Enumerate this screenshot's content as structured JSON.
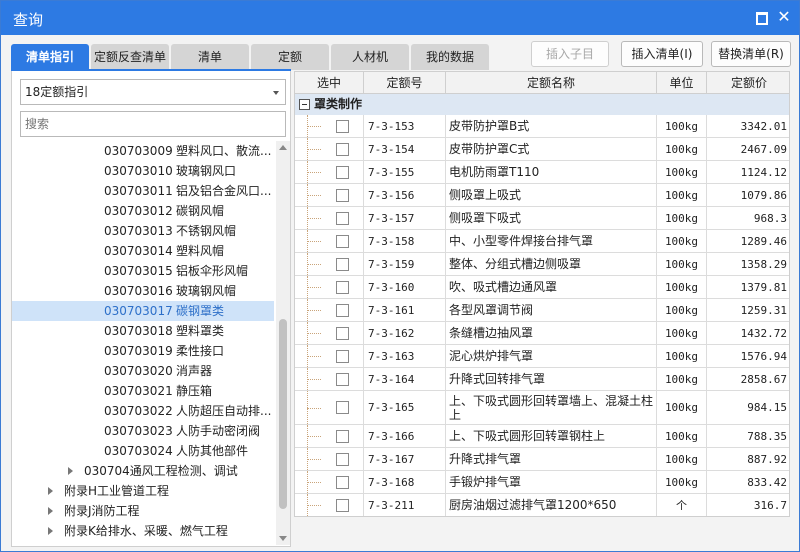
{
  "window": {
    "title": "查询"
  },
  "tabs": [
    {
      "label": "清单指引",
      "active": true
    },
    {
      "label": "定额反查清单",
      "active": false
    },
    {
      "label": "清单",
      "active": false
    },
    {
      "label": "定额",
      "active": false
    },
    {
      "label": "人材机",
      "active": false
    },
    {
      "label": "我的数据",
      "active": false
    }
  ],
  "toolbar": {
    "insert_child": "插入子目",
    "insert_list": "插入清单(I)",
    "replace_list": "替换清单(R)"
  },
  "left": {
    "select_value": "18定额指引",
    "search_placeholder": "搜索",
    "items": [
      {
        "code": "030703009",
        "name": "塑料风口、散流..."
      },
      {
        "code": "030703010",
        "name": "玻璃钢风口"
      },
      {
        "code": "030703011",
        "name": "铝及铝合金风口..."
      },
      {
        "code": "030703012",
        "name": "碳钢风帽"
      },
      {
        "code": "030703013",
        "name": "不锈钢风帽"
      },
      {
        "code": "030703014",
        "name": "塑料风帽"
      },
      {
        "code": "030703015",
        "name": "铝板伞形风帽"
      },
      {
        "code": "030703016",
        "name": "玻璃钢风帽"
      },
      {
        "code": "030703017",
        "name": "碳钢罩类"
      },
      {
        "code": "030703018",
        "name": "塑料罩类"
      },
      {
        "code": "030703019",
        "name": "柔性接口"
      },
      {
        "code": "030703020",
        "name": "消声器"
      },
      {
        "code": "030703021",
        "name": "静压箱"
      },
      {
        "code": "030703022",
        "name": "人防超压自动排..."
      },
      {
        "code": "030703023",
        "name": "人防手动密闭阀"
      },
      {
        "code": "030703024",
        "name": "人防其他部件"
      }
    ],
    "nodes": [
      "030704通风工程检测、调试",
      "附录H工业管道工程",
      "附录J消防工程",
      "附录K给排水、采暖、燃气工程"
    ]
  },
  "grid": {
    "headers": {
      "select": "选中",
      "code": "定额号",
      "name": "定额名称",
      "unit": "单位",
      "price": "定额价"
    },
    "group": "罩类制作",
    "rows": [
      {
        "code": "7-3-153",
        "name": "皮带防护罩B式",
        "unit": "100kg",
        "price": "3342.01"
      },
      {
        "code": "7-3-154",
        "name": "皮带防护罩C式",
        "unit": "100kg",
        "price": "2467.09"
      },
      {
        "code": "7-3-155",
        "name": "电机防雨罩T110",
        "unit": "100kg",
        "price": "1124.12"
      },
      {
        "code": "7-3-156",
        "name": "侧吸罩上吸式",
        "unit": "100kg",
        "price": "1079.86"
      },
      {
        "code": "7-3-157",
        "name": "侧吸罩下吸式",
        "unit": "100kg",
        "price": "968.3"
      },
      {
        "code": "7-3-158",
        "name": "中、小型零件焊接台排气罩",
        "unit": "100kg",
        "price": "1289.46"
      },
      {
        "code": "7-3-159",
        "name": "整体、分组式槽边侧吸罩",
        "unit": "100kg",
        "price": "1358.29"
      },
      {
        "code": "7-3-160",
        "name": "吹、吸式槽边通风罩",
        "unit": "100kg",
        "price": "1379.81"
      },
      {
        "code": "7-3-161",
        "name": "各型风罩调节阀",
        "unit": "100kg",
        "price": "1259.31"
      },
      {
        "code": "7-3-162",
        "name": "条缝槽边抽风罩",
        "unit": "100kg",
        "price": "1432.72"
      },
      {
        "code": "7-3-163",
        "name": "泥心烘炉排气罩",
        "unit": "100kg",
        "price": "1576.94"
      },
      {
        "code": "7-3-164",
        "name": "升降式回转排气罩",
        "unit": "100kg",
        "price": "2858.67"
      },
      {
        "code": "7-3-165",
        "name": "上、下吸式圆形回转罩墙上、混凝土柱上",
        "unit": "100kg",
        "price": "984.15"
      },
      {
        "code": "7-3-166",
        "name": "上、下吸式圆形回转罩钢柱上",
        "unit": "100kg",
        "price": "788.35"
      },
      {
        "code": "7-3-167",
        "name": "升降式排气罩",
        "unit": "100kg",
        "price": "887.92"
      },
      {
        "code": "7-3-168",
        "name": "手锻炉排气罩",
        "unit": "100kg",
        "price": "833.42"
      },
      {
        "code": "7-3-211",
        "name": "厨房油烟过滤排气罩1200*650",
        "unit": "个",
        "price": "316.7"
      }
    ]
  }
}
